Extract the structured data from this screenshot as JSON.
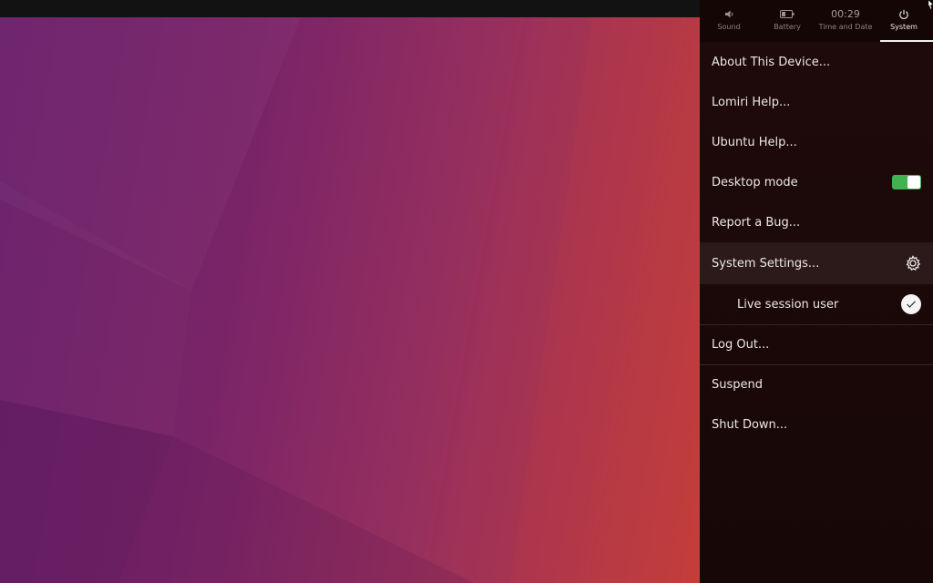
{
  "indicators": {
    "tabs": [
      {
        "label": "Sound",
        "icon": "speaker-icon"
      },
      {
        "label": "Battery",
        "icon": "battery-icon"
      },
      {
        "label": "Time and Date",
        "clock": "00:29"
      },
      {
        "label": "System",
        "icon": "power-icon",
        "active": true
      }
    ]
  },
  "system_menu": {
    "about": "About This Device...",
    "lomiri_help": "Lomiri Help...",
    "ubuntu_help": "Ubuntu Help...",
    "desktop_mode": {
      "label": "Desktop mode",
      "enabled": true
    },
    "report_bug": "Report a Bug...",
    "system_settings": "System Settings...",
    "user": {
      "label": "Live session user",
      "checked": true
    },
    "log_out": "Log Out...",
    "suspend": "Suspend",
    "shut_down": "Shut Down..."
  },
  "colors": {
    "switch_on": "#3eb34f",
    "panel_bg": "#1f0a0b",
    "highlight": "#2c1a1a"
  }
}
